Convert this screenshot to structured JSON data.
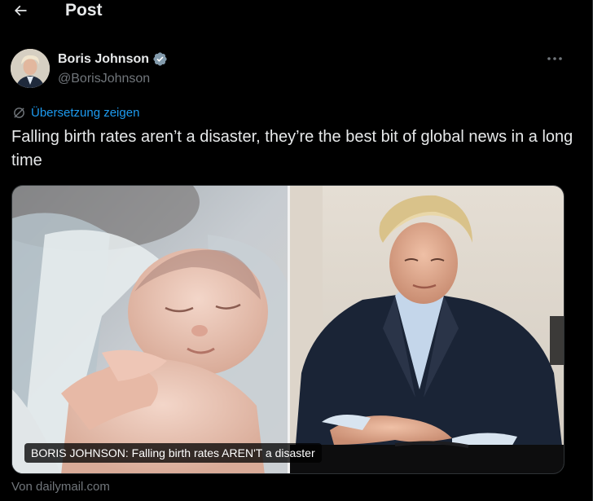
{
  "header": {
    "back_icon": "arrow-left-icon",
    "title": "Post"
  },
  "author": {
    "name": "Boris Johnson",
    "handle": "@BorisJohnson",
    "verified_icon": "verified-badge-icon",
    "verified_color": "#829aab",
    "more_icon": "more-horizontal-icon"
  },
  "translate": {
    "icon": "translate-icon",
    "label": "Übersetzung zeigen",
    "color": "#1d9bf0"
  },
  "tweet": {
    "text": "Falling birth rates aren’t a disaster, they’re the best bit of global news in a long time"
  },
  "card": {
    "caption": "BORIS JOHNSON: Falling birth rates AREN'T a disaster",
    "source": "Von dailymail.com"
  },
  "theme": {
    "background": "#000000",
    "text": "#e7e9ea",
    "muted": "#71767b",
    "border": "#2f3336"
  }
}
